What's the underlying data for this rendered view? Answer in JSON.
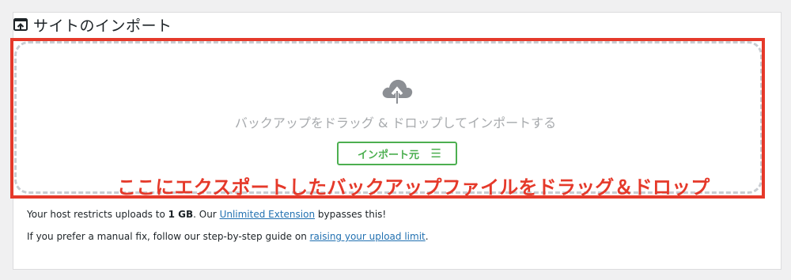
{
  "header": {
    "title": "サイトのインポート",
    "icon": "import-upload-icon"
  },
  "dropzone": {
    "icon": "cloud-upload-icon",
    "text": "バックアップをドラッグ & ドロップしてインポートする",
    "import_button_label": "インポート元",
    "import_button_icon": "menu-icon"
  },
  "annotation": {
    "text": "ここにエクスポートしたバックアップファイルをドラッグ＆ドロップ",
    "color": "#e5392a"
  },
  "notes": {
    "line1_prefix": "Your host restricts uploads to ",
    "line1_limit": "1 GB",
    "line1_middle": ". Our ",
    "line1_link": "Unlimited Extension",
    "line1_suffix": " bypasses this!",
    "line2_prefix": "If you prefer a manual fix, follow our step-by-step guide on ",
    "line2_link": "raising your upload limit",
    "line2_suffix": "."
  },
  "colors": {
    "accent_green": "#4caf50",
    "link_blue": "#2271b1",
    "highlight_red": "#e5392a"
  }
}
